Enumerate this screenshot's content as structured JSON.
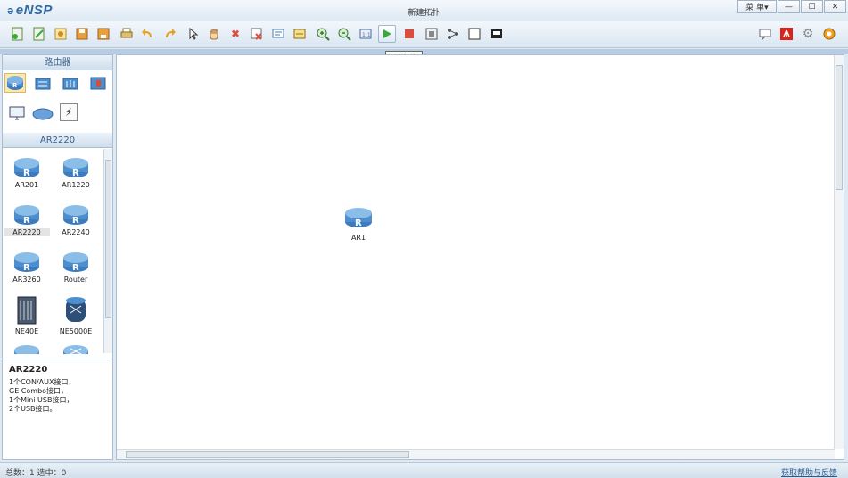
{
  "app": {
    "logo": "eNSP",
    "window_title": "新建拓扑"
  },
  "window_controls": {
    "menu_label": "菜 单▾",
    "minimize": "—",
    "maximize": "☐",
    "close": "✕"
  },
  "toolbar": {
    "tooltip": "开启设备",
    "left_icons": [
      "new-topology-icon",
      "new-template-icon",
      "open-icon",
      "save-icon",
      "save-as-icon",
      "print-icon",
      "undo-icon",
      "redo-icon",
      "select-pointer-icon",
      "pan-hand-icon",
      "delete-icon",
      "delete-link-icon",
      "add-note-icon",
      "add-rectangle-icon",
      "zoom-in-icon",
      "zoom-out-icon",
      "fit-window-icon",
      "start-device-icon",
      "stop-device-icon",
      "capture-icon",
      "topology-icon",
      "frame-icon",
      "screenshot-icon"
    ],
    "right_icons": [
      "chat-icon",
      "huawei-icon",
      "settings-icon",
      "help-icon"
    ]
  },
  "left_panel": {
    "category_title": "路由器",
    "category_icons": [
      "router-category-icon",
      "switch-category-icon",
      "wireless-category-icon",
      "firewall-category-icon",
      "pc-category-icon",
      "cloud-category-icon",
      "link-category-icon"
    ],
    "model_title": "AR2220",
    "devices": [
      {
        "label": "AR201",
        "icon": "router-icon"
      },
      {
        "label": "AR1220",
        "icon": "router-icon"
      },
      {
        "label": "AR2220",
        "icon": "router-icon"
      },
      {
        "label": "AR2240",
        "icon": "router-icon"
      },
      {
        "label": "AR3260",
        "icon": "router-icon"
      },
      {
        "label": "Router",
        "icon": "router-icon"
      },
      {
        "label": "NE40E",
        "icon": "ne40e-icon"
      },
      {
        "label": "NE5000E",
        "icon": "ne5000e-icon"
      }
    ],
    "description": {
      "title": "AR2220",
      "lines": [
        "1个CON/AUX接口，",
        "GE Combo接口，",
        "1个Mini USB接口，",
        "2个USB接口。"
      ]
    }
  },
  "canvas": {
    "nodes": [
      {
        "label": "AR1",
        "icon": "router-icon"
      }
    ]
  },
  "statusbar": {
    "status": "总数：1  选中：0",
    "help_link": "获取帮助与反馈"
  },
  "colors": {
    "accent": "#2f6aa3",
    "router_blue": "#4d8fce",
    "start_green": "#3aa83a",
    "stop_red": "#e04a3a"
  }
}
